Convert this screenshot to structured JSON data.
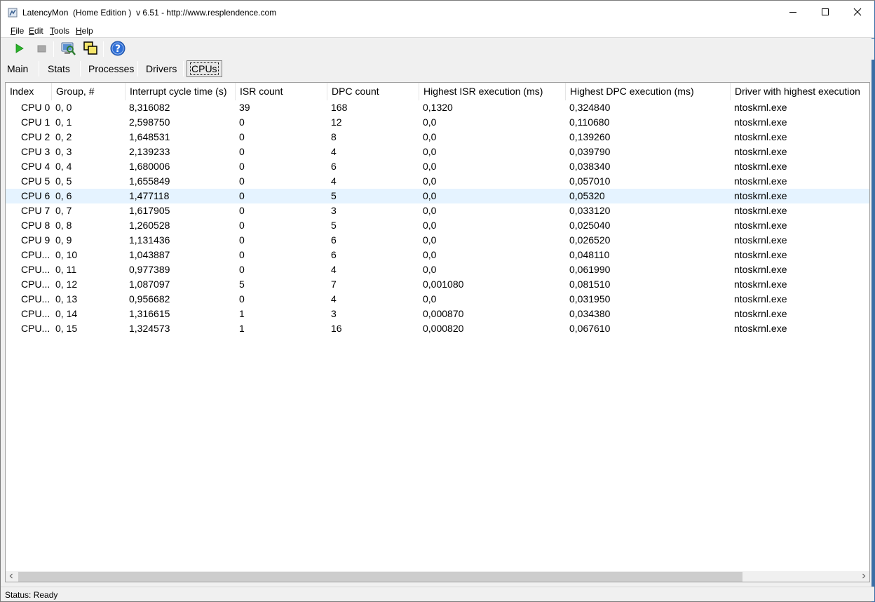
{
  "window": {
    "title": "LatencyMon  (Home Edition )  v 6.51 - http://www.resplendence.com"
  },
  "menu": [
    {
      "label_u": "F",
      "label_rest": "ile"
    },
    {
      "label_u": "E",
      "label_rest": "dit"
    },
    {
      "label_u": "T",
      "label_rest": "ools"
    },
    {
      "label_u": "H",
      "label_rest": "elp"
    }
  ],
  "toolbar": {
    "icons": [
      "play-icon",
      "stop-icon",
      "system-info-icon",
      "windows-icon",
      "help-icon"
    ]
  },
  "tabs": [
    "Main",
    "Stats",
    "Processes",
    "Drivers",
    "CPUs"
  ],
  "active_tab": "CPUs",
  "table": {
    "columns": [
      "Index",
      "Group, #",
      "Interrupt cycle time (s)",
      "ISR count",
      "DPC count",
      "Highest ISR execution (ms)",
      "Highest DPC execution (ms)",
      "Driver with highest execution"
    ],
    "rows": [
      [
        "CPU 0",
        "0, 0",
        "8,316082",
        "39",
        "168",
        "0,1320",
        "0,324840",
        "ntoskrnl.exe"
      ],
      [
        "CPU 1",
        "0, 1",
        "2,598750",
        "0",
        "12",
        "0,0",
        "0,110680",
        "ntoskrnl.exe"
      ],
      [
        "CPU 2",
        "0, 2",
        "1,648531",
        "0",
        "8",
        "0,0",
        "0,139260",
        "ntoskrnl.exe"
      ],
      [
        "CPU 3",
        "0, 3",
        "2,139233",
        "0",
        "4",
        "0,0",
        "0,039790",
        "ntoskrnl.exe"
      ],
      [
        "CPU 4",
        "0, 4",
        "1,680006",
        "0",
        "6",
        "0,0",
        "0,038340",
        "ntoskrnl.exe"
      ],
      [
        "CPU 5",
        "0, 5",
        "1,655849",
        "0",
        "4",
        "0,0",
        "0,057010",
        "ntoskrnl.exe"
      ],
      [
        "CPU 6",
        "0, 6",
        "1,477118",
        "0",
        "5",
        "0,0",
        "0,05320",
        "ntoskrnl.exe"
      ],
      [
        "CPU 7",
        "0, 7",
        "1,617905",
        "0",
        "3",
        "0,0",
        "0,033120",
        "ntoskrnl.exe"
      ],
      [
        "CPU 8",
        "0, 8",
        "1,260528",
        "0",
        "5",
        "0,0",
        "0,025040",
        "ntoskrnl.exe"
      ],
      [
        "CPU 9",
        "0, 9",
        "1,131436",
        "0",
        "6",
        "0,0",
        "0,026520",
        "ntoskrnl.exe"
      ],
      [
        "CPU...",
        "0, 10",
        "1,043887",
        "0",
        "6",
        "0,0",
        "0,048110",
        "ntoskrnl.exe"
      ],
      [
        "CPU...",
        "0, 11",
        "0,977389",
        "0",
        "4",
        "0,0",
        "0,061990",
        "ntoskrnl.exe"
      ],
      [
        "CPU...",
        "0, 12",
        "1,087097",
        "5",
        "7",
        "0,001080",
        "0,081510",
        "ntoskrnl.exe"
      ],
      [
        "CPU...",
        "0, 13",
        "0,956682",
        "0",
        "4",
        "0,0",
        "0,031950",
        "ntoskrnl.exe"
      ],
      [
        "CPU...",
        "0, 14",
        "1,316615",
        "1",
        "3",
        "0,000870",
        "0,034380",
        "ntoskrnl.exe"
      ],
      [
        "CPU...",
        "0, 15",
        "1,324573",
        "1",
        "16",
        "0,000820",
        "0,067610",
        "ntoskrnl.exe"
      ]
    ],
    "highlighted_row": "CPU 6"
  },
  "status": {
    "text": "Status: Ready"
  },
  "colors": {
    "row_highlight": "#e5f3ff",
    "play_green": "#2db52d"
  }
}
